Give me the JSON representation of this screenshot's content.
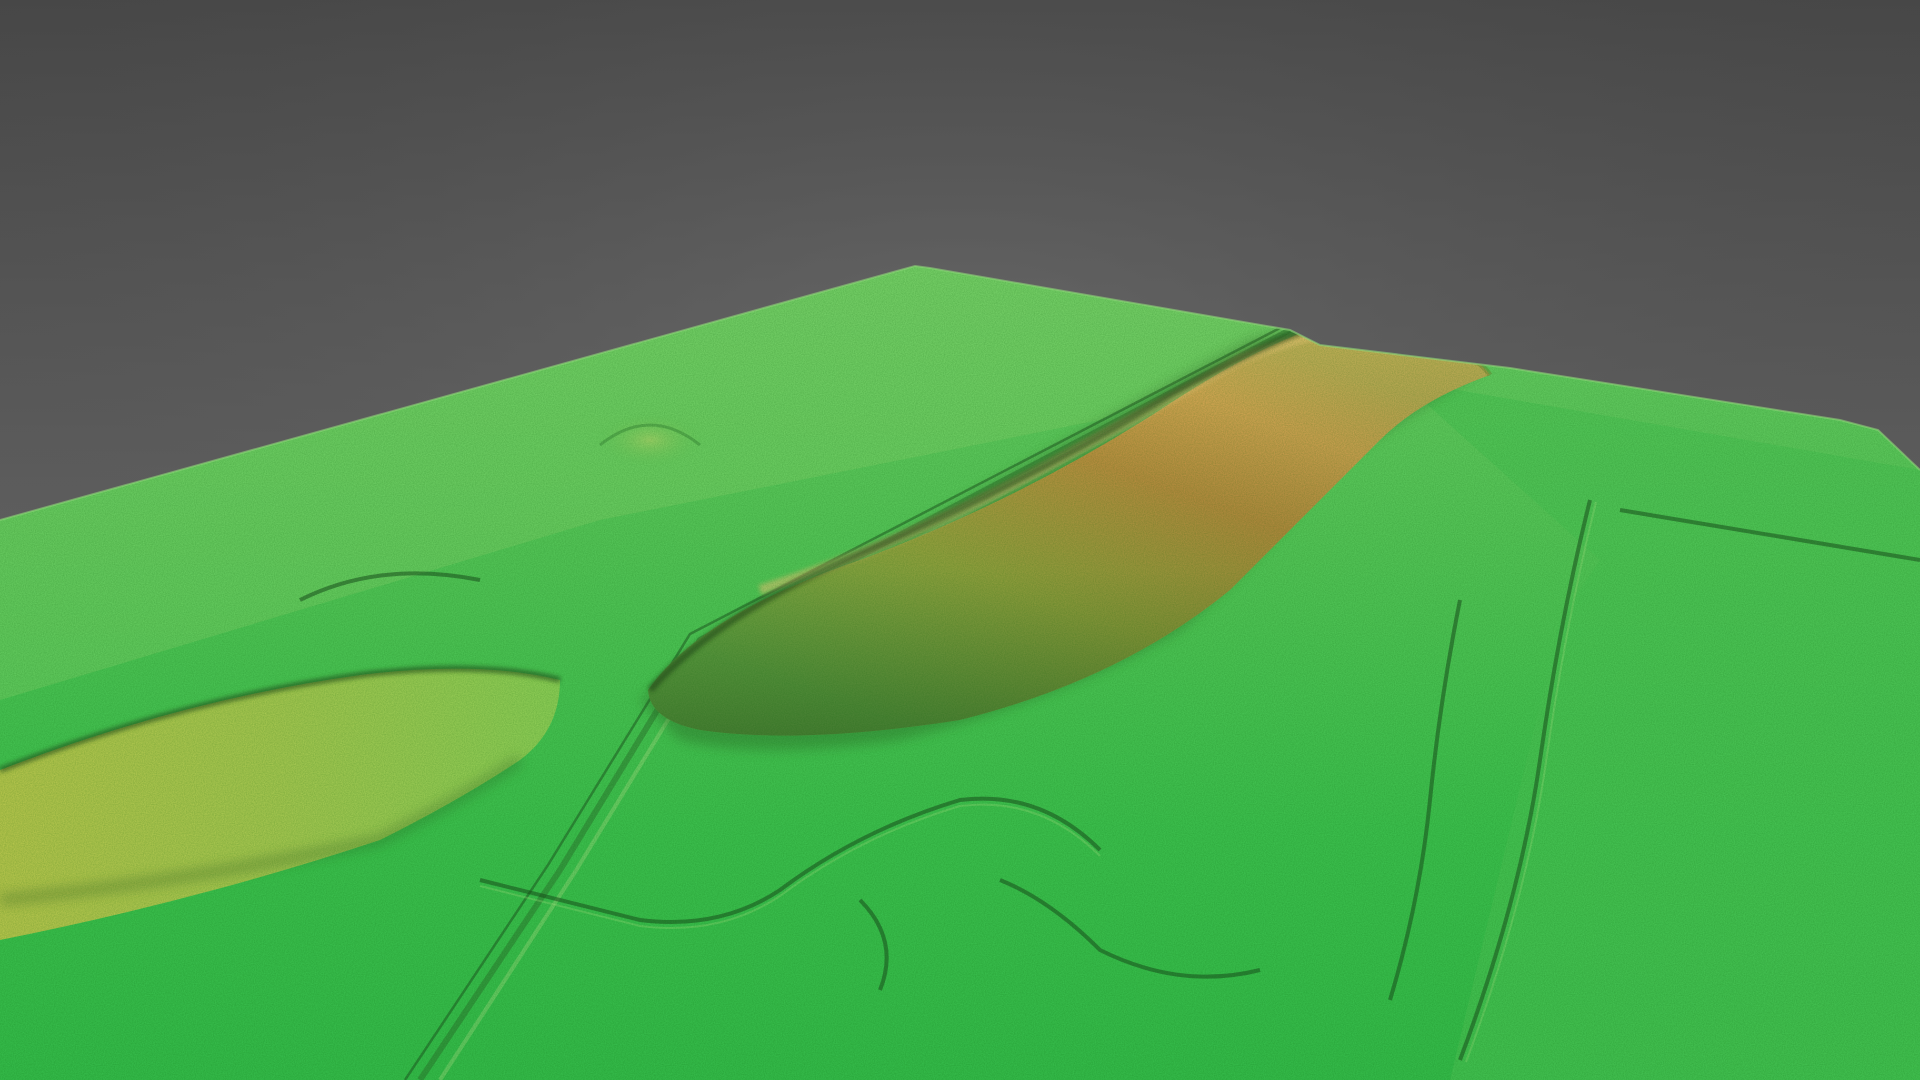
{
  "scene": {
    "subject": "terrain-elevation-model",
    "rendering": "3d-hillshade-color-ramp",
    "colors": {
      "background_top": "#4a4a4a",
      "background_bottom": "#6e6e6e",
      "low_terrain": "#2fbf4a",
      "mid_terrain": "#7fd35a",
      "ridge_yellow": "#c9c24e",
      "ridge_orange": "#d9a24a",
      "ridge_crest": "#e8b55c",
      "shadow": "#1f4a22"
    },
    "features": [
      "background",
      "terrain-plane",
      "main-ridge",
      "secondary-ridge",
      "mound",
      "road",
      "field-boundaries",
      "ditch-lines"
    ]
  }
}
